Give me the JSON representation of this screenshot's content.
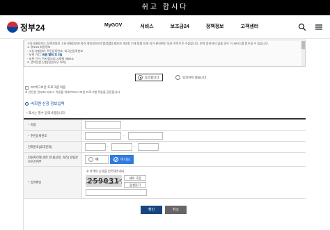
{
  "top_banner": {
    "text": "쉬고 합시다"
  },
  "header": {
    "logo_text": "정부24",
    "nav": [
      "MyGOV",
      "서비스",
      "보조금24",
      "정책정보",
      "고객센터"
    ],
    "icons": [
      "search-icon",
      "menu-icon"
    ]
  },
  "terms": {
    "lines": [
      "고유식별정보는 정책지원의 고유식별정보에 따라 개인정보보호법(법률) 제24조 제1항 기재 법령 등에 의거 본인확인 등의 목적으로 수집합니다. 만약 동의하지 않을 경우 이 서비스를 받으실 수 없습니다.",
      "1. 정보24 회원정보",
      " - 고유식별정보: 주민등록번호, 외국인등록번호",
      " - 보관 기간: ",
      " - 보관 근거: 전자정부법 시행령 제90조",
      "2. 전자민원 신청(민원사무 처리)"
    ],
    "retention_highlight": "회원 탈퇴 후 5일"
  },
  "agreement": {
    "agree_label": "동의합니다.",
    "disagree_label": "동의하지 않습니다."
  },
  "pc_program": {
    "checkbox_label": "PC버그보안 프로그램 적용",
    "note": "※ 안전한 정부24 서비스 이용을 위해 PC버그보안 프로그램 적용을 권장합니다."
  },
  "section": {
    "title": "비회원 신청 정보입력",
    "required_note": "표시는 필수 입력사항입니다."
  },
  "form": {
    "name_label": "이름",
    "rrn_label": "주민등록번호",
    "phone_label": "전화번호(휴대전화)",
    "phone_dash": "-",
    "sms_label": "민원처리에 관한 안내(신청, 처리) 알림문자수신여부",
    "sms_yes": "예",
    "sms_no": "아니요",
    "captcha_label": "입력확인",
    "captcha_note": "※ 아래의 숫자를 입력해주세요.",
    "captcha_value": "259031",
    "captcha_refresh": "새로 고침",
    "captcha_audio": "음성듣기"
  },
  "buttons": {
    "confirm": "확인",
    "cancel": "취소"
  },
  "colors": {
    "primary": "#17467f",
    "accent": "#2f7be0",
    "required": "#d62d2d",
    "link": "#0b4ea2"
  }
}
